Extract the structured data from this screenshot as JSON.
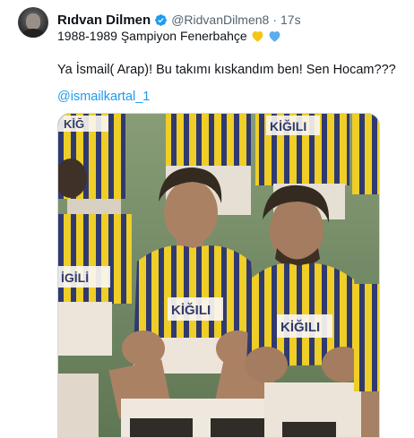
{
  "author": {
    "name": "Rıdvan Dilmen",
    "handle": "@RidvanDilmen8",
    "separator": "·",
    "time": "17s"
  },
  "subline": {
    "text": "1988-1989 Şampiyon Fenerbahçe",
    "hearts": [
      "yellow-heart-icon",
      "blue-heart-icon"
    ]
  },
  "tweet": {
    "text": "Ya İsmail( Arap)! Bu takımı kıskandım ben! Sen Hocam???",
    "mention": "@ismailkartal_1"
  },
  "media": {
    "shirt_text_left": "İGİLİ",
    "shirt_text_center": "KİĞILI",
    "shirt_text_right": "KİĞILI",
    "shirt_text_top_left": "KİĞ",
    "shirt_text_top_mid": "KİĞILI"
  },
  "colors": {
    "link": "#1d9bf0",
    "verified": "#1d9bf0",
    "heart_yellow": "#f5c518",
    "heart_blue": "#5dadec",
    "kit_yellow": "#f2d21a",
    "kit_navy": "#1b2a6b"
  }
}
